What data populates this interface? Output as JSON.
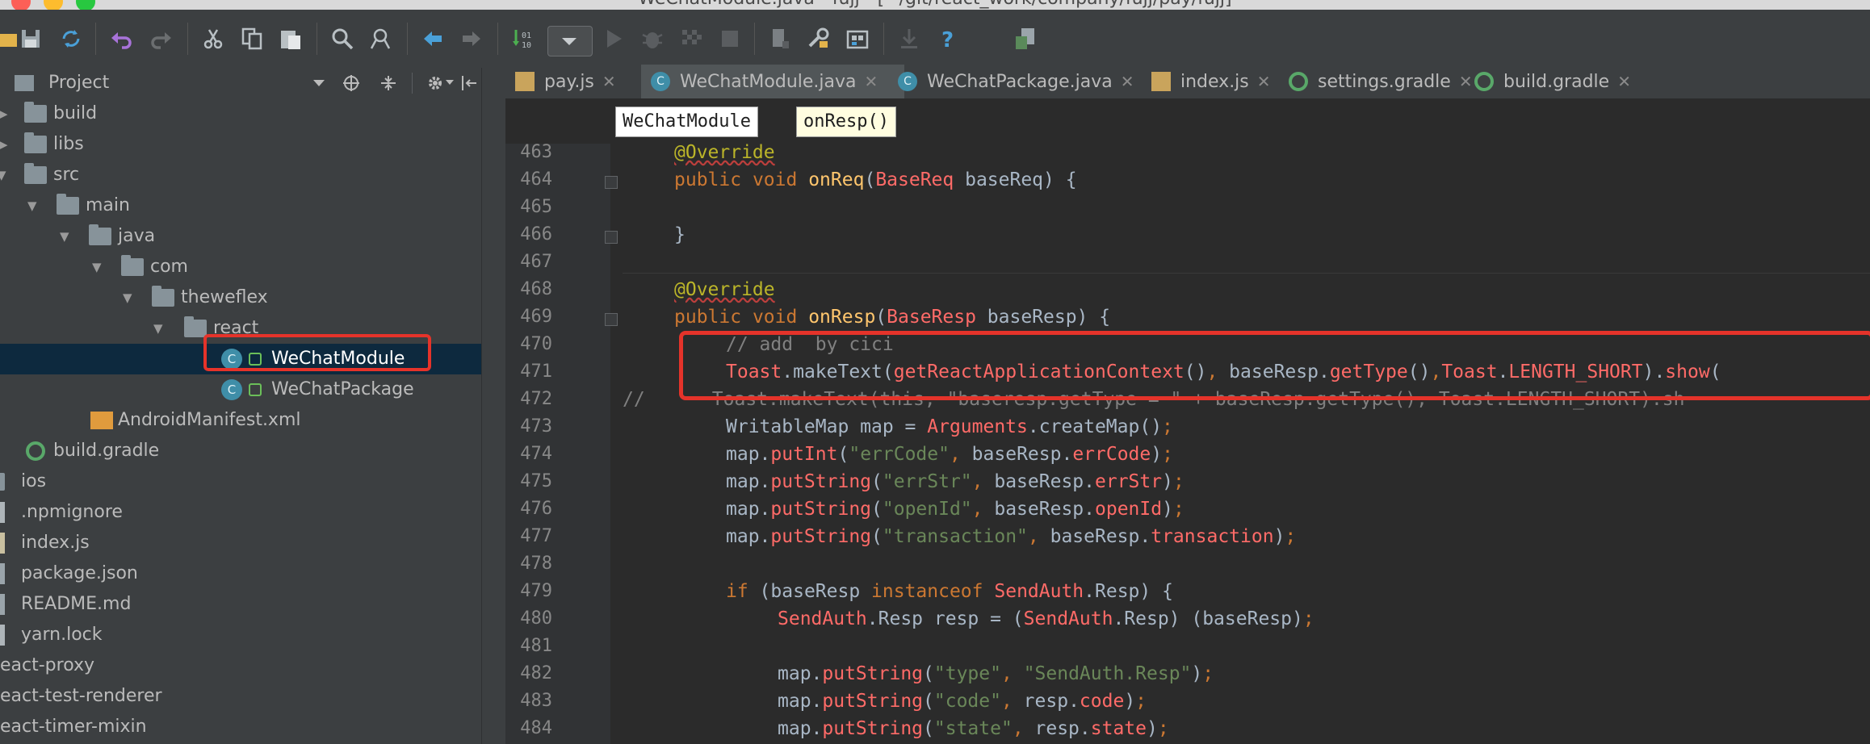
{
  "window": {
    "title": "WeChatModule.java - fujj - [~/git/react_work/company/fujj/pay/fujj]"
  },
  "project_panel": {
    "title": "Project",
    "tree": [
      {
        "label": "build",
        "type": "folder",
        "depth": 0,
        "expanded": false
      },
      {
        "label": "libs",
        "type": "folder",
        "depth": 0,
        "expanded": false
      },
      {
        "label": "src",
        "type": "folder",
        "depth": 0,
        "expanded": true
      },
      {
        "label": "main",
        "type": "folder",
        "depth": 1,
        "expanded": true
      },
      {
        "label": "java",
        "type": "folder",
        "depth": 2,
        "expanded": true
      },
      {
        "label": "com",
        "type": "folder",
        "depth": 3,
        "expanded": true
      },
      {
        "label": "theweflex",
        "type": "folder",
        "depth": 4,
        "expanded": true
      },
      {
        "label": "react",
        "type": "folder",
        "depth": 5,
        "expanded": true
      },
      {
        "label": "WeChatModule",
        "type": "class",
        "depth": 6,
        "selected": true
      },
      {
        "label": "WeChatPackage",
        "type": "class",
        "depth": 6
      },
      {
        "label": "AndroidManifest.xml",
        "type": "xml",
        "depth": 2
      },
      {
        "label": "build.gradle",
        "type": "gradle",
        "depth": 0
      },
      {
        "label": "ios",
        "type": "folder-root"
      },
      {
        "label": ".npmignore",
        "type": "file-root"
      },
      {
        "label": "index.js",
        "type": "js-root"
      },
      {
        "label": "package.json",
        "type": "json-root"
      },
      {
        "label": "README.md",
        "type": "md-root"
      },
      {
        "label": "yarn.lock",
        "type": "file-root"
      },
      {
        "label": "eact-proxy",
        "type": "text-root"
      },
      {
        "label": "eact-test-renderer",
        "type": "text-root"
      },
      {
        "label": "eact-timer-mixin",
        "type": "text-root"
      }
    ]
  },
  "tabs": [
    {
      "label": "pay.js",
      "icon": "js-file-icon",
      "active": false
    },
    {
      "label": "WeChatModule.java",
      "icon": "java-class-icon",
      "active": true
    },
    {
      "label": "WeChatPackage.java",
      "icon": "java-class-icon",
      "active": false
    },
    {
      "label": "index.js",
      "icon": "js-file-icon",
      "active": false
    },
    {
      "label": "settings.gradle",
      "icon": "gradle-icon",
      "active": false
    },
    {
      "label": "build.gradle",
      "icon": "gradle-icon",
      "active": false
    }
  ],
  "breadcrumb": [
    "WeChatModule",
    "onResp()"
  ],
  "code_lines": [
    {
      "n": "463",
      "text": "@Override"
    },
    {
      "n": "464",
      "text": "public void onReq(BaseReq baseReq) {"
    },
    {
      "n": "465",
      "text": ""
    },
    {
      "n": "466",
      "text": "}"
    },
    {
      "n": "467",
      "text": ""
    },
    {
      "n": "468",
      "text": "@Override"
    },
    {
      "n": "469",
      "text": "public void onResp(BaseResp baseResp) {"
    },
    {
      "n": "470",
      "text": "// add  by cici"
    },
    {
      "n": "471",
      "text": "Toast.makeText(getReactApplicationContext(), baseResp.getType(),Toast.LENGTH_SHORT).show("
    },
    {
      "n": "472",
      "text": "//      Toast.makeText(this, \"baseresp.getType = \" + baseResp.getType(), Toast.LENGTH_SHORT).sh"
    },
    {
      "n": "473",
      "text": "WritableMap map = Arguments.createMap();"
    },
    {
      "n": "474",
      "text": "map.putInt(\"errCode\", baseResp.errCode);"
    },
    {
      "n": "475",
      "text": "map.putString(\"errStr\", baseResp.errStr);"
    },
    {
      "n": "476",
      "text": "map.putString(\"openId\", baseResp.openId);"
    },
    {
      "n": "477",
      "text": "map.putString(\"transaction\", baseResp.transaction);"
    },
    {
      "n": "478",
      "text": ""
    },
    {
      "n": "479",
      "text": "if (baseResp instanceof SendAuth.Resp) {"
    },
    {
      "n": "480",
      "text": "SendAuth.Resp resp = (SendAuth.Resp) (baseResp);"
    },
    {
      "n": "481",
      "text": ""
    },
    {
      "n": "482",
      "text": "map.putString(\"type\", \"SendAuth.Resp\");"
    },
    {
      "n": "483",
      "text": "map.putString(\"code\", resp.code);"
    },
    {
      "n": "484",
      "text": "map.putString(\"state\", resp.state);"
    }
  ],
  "colors": {
    "highlight_box": "#e5332a",
    "keyword": "#cc7832",
    "annotation": "#bbb529",
    "method": "#ffc66d",
    "string": "#6a8759",
    "field": "#ff6b68",
    "comment": "#808080",
    "selection": "#0d293e"
  }
}
